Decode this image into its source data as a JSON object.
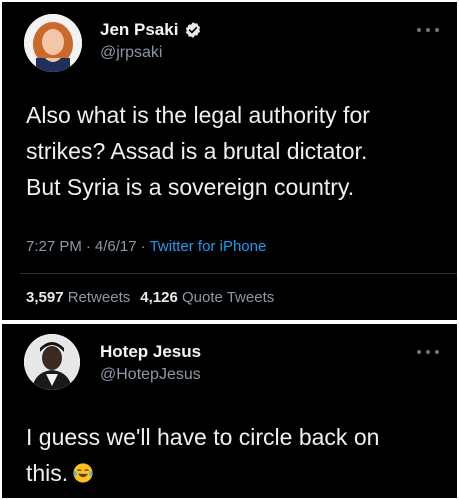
{
  "tweet1": {
    "name": "Jen Psaki",
    "handle": "@jrpsaki",
    "verified": true,
    "text_line1": "Also what is the legal authority for",
    "text_line2": "strikes? Assad is a brutal dictator.",
    "text_line3": "But Syria is a sovereign country.",
    "time": "7:27 PM",
    "date": "4/6/17",
    "source": "Twitter for iPhone",
    "retweets_count": "3,597",
    "retweets_label": "Retweets",
    "quote_count": "4,126",
    "quote_label": "Quote Tweets"
  },
  "tweet2": {
    "name": "Hotep Jesus",
    "handle": "@HotepJesus",
    "text_line1": "I guess we'll have to circle back on",
    "text_line2": "this."
  },
  "icons": {
    "verified": "verified-badge-icon",
    "more": "more-options-icon",
    "emoji": "face-with-tears-of-joy-emoji"
  },
  "colors": {
    "background": "#000000",
    "text": "#e7e9ea",
    "muted": "#8b98a5",
    "link": "#1d9bf0"
  }
}
